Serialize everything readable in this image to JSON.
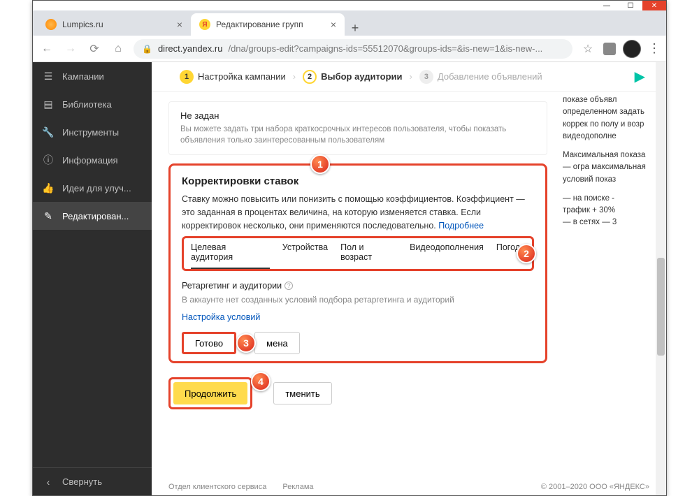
{
  "window": {
    "tabs": [
      {
        "title": "Lumpics.ru",
        "active": false
      },
      {
        "title": "Редактирование групп",
        "active": true
      }
    ]
  },
  "urlbar": {
    "host": "direct.yandex.ru",
    "path": "/dna/groups-edit?campaigns-ids=55512070&groups-ids=&is-new=1&is-new-..."
  },
  "sidebar": {
    "items": [
      {
        "label": "Кампании",
        "icon": "menu"
      },
      {
        "label": "Библиотека",
        "icon": "book"
      },
      {
        "label": "Инструменты",
        "icon": "wrench"
      },
      {
        "label": "Информация",
        "icon": "info"
      },
      {
        "label": "Идеи для улуч...",
        "icon": "thumb"
      },
      {
        "label": "Редактирован...",
        "icon": "pencil",
        "active": true
      }
    ],
    "collapse": "Свернуть"
  },
  "steps": {
    "s1": "Настройка кампании",
    "s2": "Выбор аудитории",
    "s3": "Добавление объявлений"
  },
  "top_block": {
    "title": "Не задан",
    "sub": "Вы можете задать три набора краткосрочных интересов пользователя, чтобы показать объявления только заинтересованным пользователям"
  },
  "bids": {
    "title": "Корректировки ставок",
    "desc": "Ставку можно повысить или понизить с помощью коэффициентов. Коэффициент — это заданная в процентах величина, на которую изменяется ставка. Если корректировок несколько, они применяются последовательно.",
    "more": "Подробнее",
    "tabs": {
      "t1": "Целевая аудитория",
      "t2": "Устройства",
      "t3": "Пол и возраст",
      "t4": "Видеодополнения",
      "t5": "Погода"
    },
    "retarget_label": "Ретаргетинг и аудитории",
    "retarget_empty": "В аккаунте нет созданных условий подбора ретаргетинга и аудиторий",
    "setup_link": "Настройка условий",
    "done_btn": "Готово",
    "cancel_btn": "мена"
  },
  "bottom": {
    "continue": "Продолжить",
    "cancel": "тменить"
  },
  "right_snip": {
    "p1": "показе объявл определенном задать коррек по полу и возр видеодополне",
    "p2": "Максимальная показа — огра максимальная условий показ",
    "l1": "—   на поиске -",
    "l2": "трафик + 30%",
    "l3": "—   в сетях — 3"
  },
  "footer": {
    "left1": "Отдел клиентского сервиса",
    "left2": "Реклама",
    "right": "© 2001–2020  ООО «ЯНДЕКС»"
  },
  "badges": {
    "b1": "1",
    "b2": "2",
    "b3": "3",
    "b4": "4"
  }
}
